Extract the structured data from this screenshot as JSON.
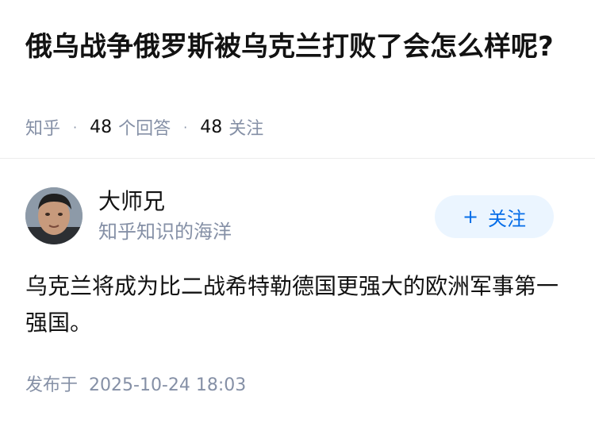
{
  "question": {
    "title": "俄乌战争俄罗斯被乌克兰打败了会怎么样呢?",
    "source": "知乎",
    "answer_count": "48",
    "answer_label": "个回答",
    "follow_count": "48",
    "follow_label": "关注"
  },
  "author": {
    "name": "大师兄",
    "bio": "知乎知识的海洋",
    "avatar_icon": "avatar-photo",
    "follow_button": {
      "icon": "plus-icon",
      "label": "关注"
    }
  },
  "answer": {
    "content": "乌克兰将成为比二战希特勒德国更强大的欧洲军事第一强国。",
    "publish_label": "发布于",
    "publish_time": "2025-10-24 18:03"
  },
  "colors": {
    "meta_gray": "#8590a6",
    "accent_blue": "#056de8",
    "follow_bg": "#ebf5ff"
  }
}
